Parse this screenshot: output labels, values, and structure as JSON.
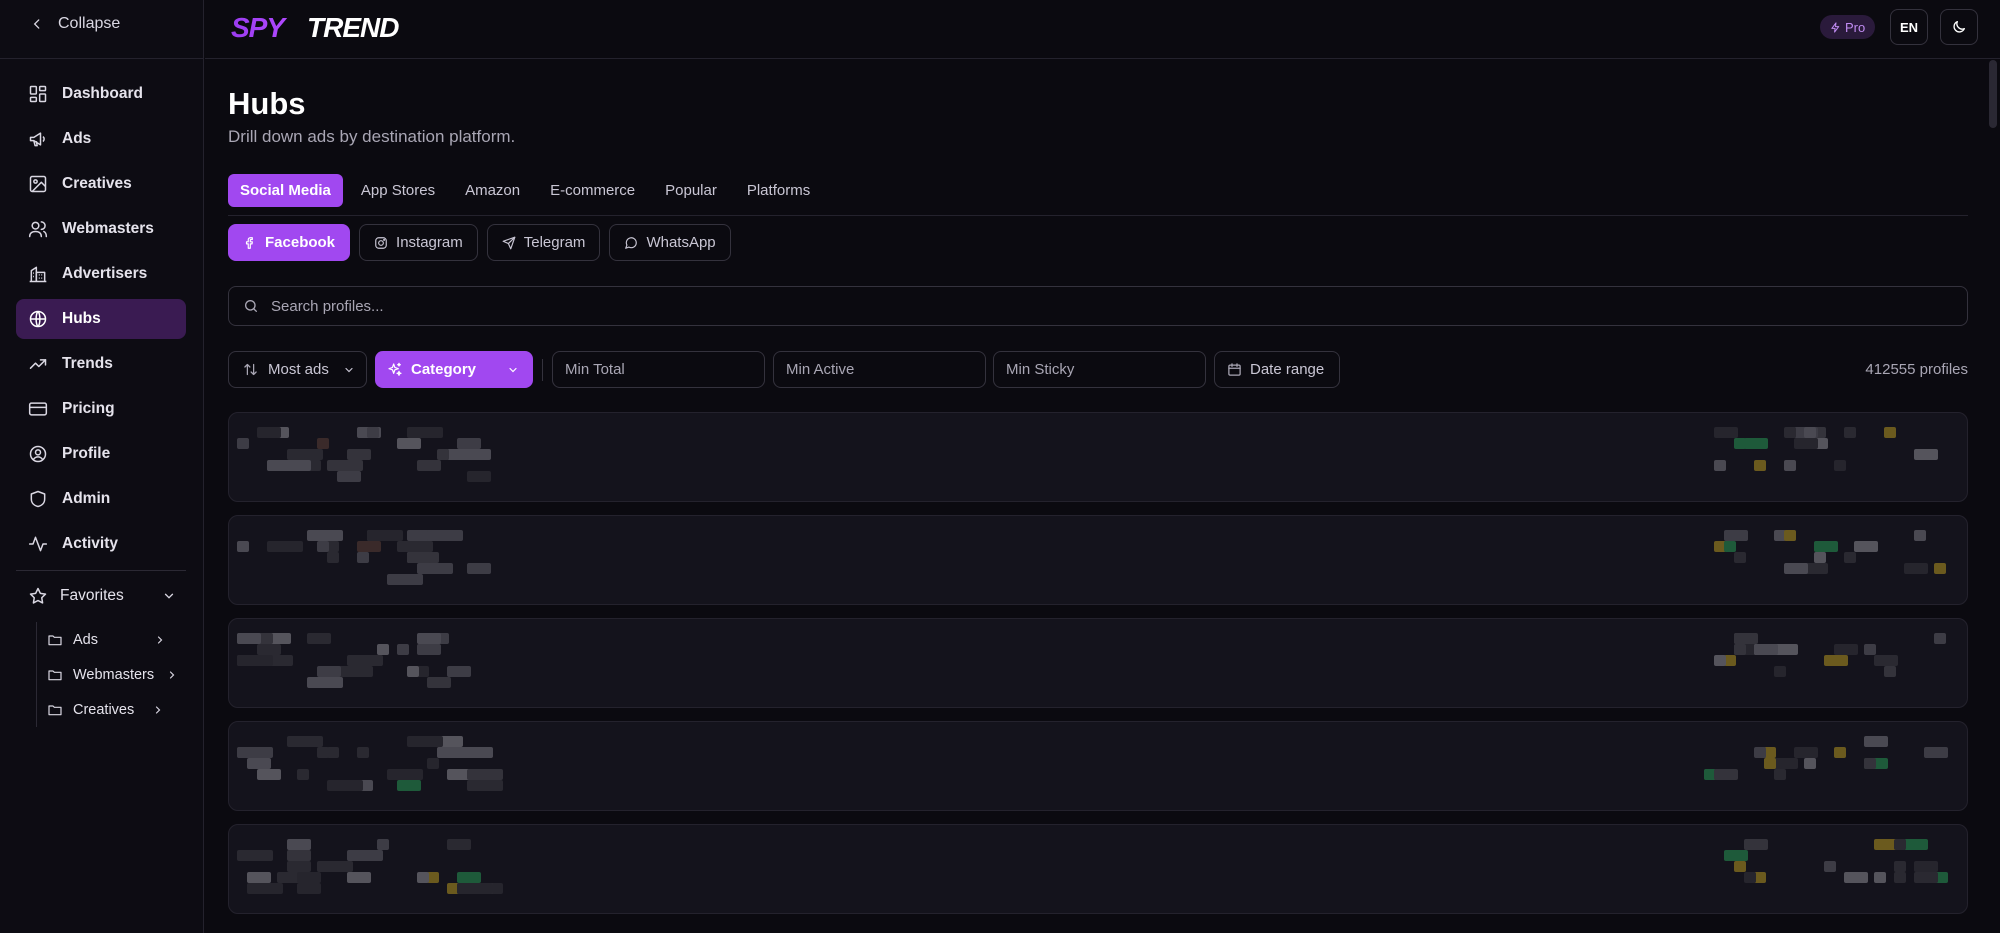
{
  "sidebar": {
    "collapse_label": "Collapse",
    "nav": [
      {
        "label": "Dashboard",
        "icon": "dashboard-icon"
      },
      {
        "label": "Ads",
        "icon": "megaphone-icon"
      },
      {
        "label": "Creatives",
        "icon": "image-icon"
      },
      {
        "label": "Webmasters",
        "icon": "users-icon"
      },
      {
        "label": "Advertisers",
        "icon": "building-icon"
      },
      {
        "label": "Hubs",
        "icon": "globe-icon",
        "active": true
      },
      {
        "label": "Trends",
        "icon": "trending-up-icon"
      },
      {
        "label": "Pricing",
        "icon": "credit-card-icon"
      },
      {
        "label": "Profile",
        "icon": "user-circle-icon"
      },
      {
        "label": "Admin",
        "icon": "shield-icon"
      },
      {
        "label": "Activity",
        "icon": "activity-icon"
      }
    ],
    "favorites": {
      "label": "Favorites",
      "items": [
        {
          "label": "Ads"
        },
        {
          "label": "Webmasters"
        },
        {
          "label": "Creatives"
        }
      ]
    }
  },
  "topbar": {
    "logo_text": "SPYTREND",
    "pro_label": "Pro",
    "lang_label": "EN"
  },
  "page": {
    "title": "Hubs",
    "subtitle": "Drill down ads by destination platform."
  },
  "tabs": [
    {
      "label": "Social Media",
      "active": true
    },
    {
      "label": "App Stores"
    },
    {
      "label": "Amazon"
    },
    {
      "label": "E-commerce"
    },
    {
      "label": "Popular"
    },
    {
      "label": "Platforms"
    }
  ],
  "platforms": [
    {
      "label": "Facebook",
      "icon": "facebook-icon",
      "active": true
    },
    {
      "label": "Instagram",
      "icon": "instagram-icon"
    },
    {
      "label": "Telegram",
      "icon": "send-icon"
    },
    {
      "label": "WhatsApp",
      "icon": "message-circle-icon"
    }
  ],
  "search": {
    "placeholder": "Search profiles..."
  },
  "filters": {
    "sort_label": "Most ads",
    "category_label": "Category",
    "min_total_placeholder": "Min Total",
    "min_active_placeholder": "Min Active",
    "min_sticky_placeholder": "Min Sticky",
    "date_range_label": "Date range",
    "count_label": "412555 profiles"
  },
  "colors": {
    "accent": "#a148f0",
    "background": "#0b0a10",
    "sidebar_active": "#3a1b52"
  }
}
